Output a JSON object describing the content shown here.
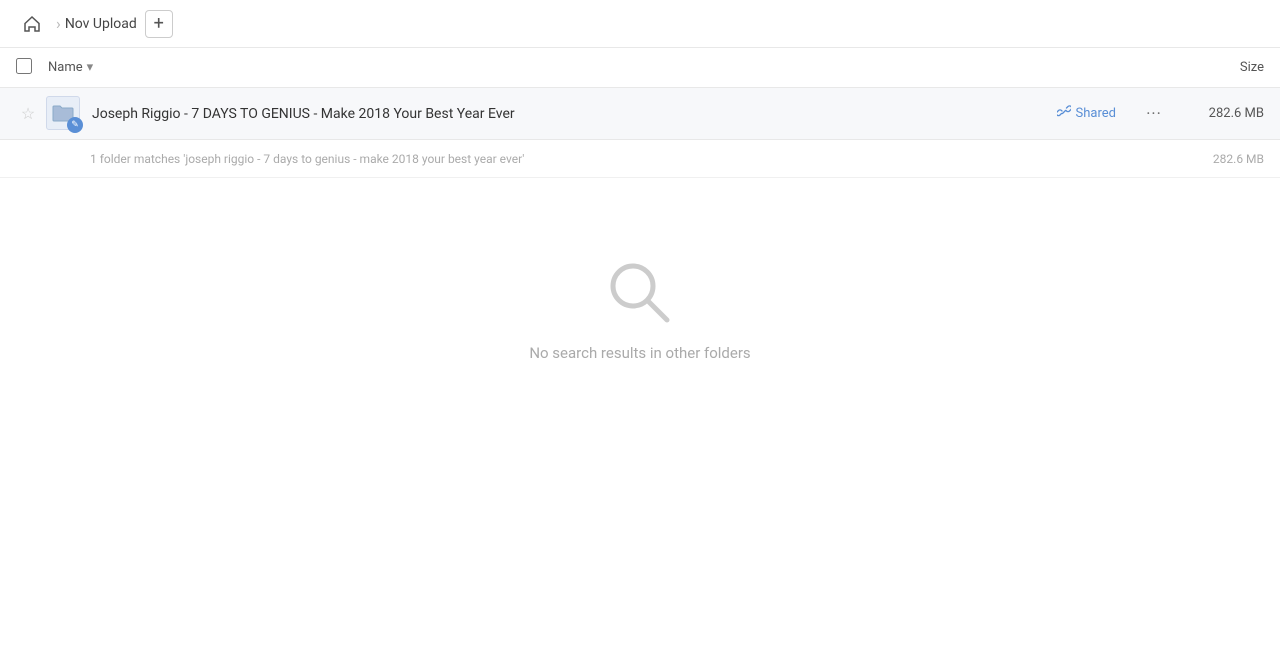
{
  "topbar": {
    "home_label": "Home",
    "breadcrumb": "Nov Upload",
    "add_label": "+"
  },
  "columns": {
    "name_label": "Name",
    "size_label": "Size"
  },
  "file": {
    "name": "Joseph Riggio - 7 DAYS TO GENIUS - Make 2018 Your Best Year Ever",
    "shared_label": "Shared",
    "more_label": "···",
    "size": "282.6 MB",
    "match_text": "1 folder matches 'joseph riggio - 7 days to genius - make 2018 your best year ever'",
    "match_size": "282.6 MB"
  },
  "empty_state": {
    "text": "No search results in other folders"
  },
  "icons": {
    "home": "🏠",
    "star_empty": "☆",
    "link": "🔗",
    "chevron_down": "▾",
    "search": "🔍",
    "pencil": "✎"
  }
}
